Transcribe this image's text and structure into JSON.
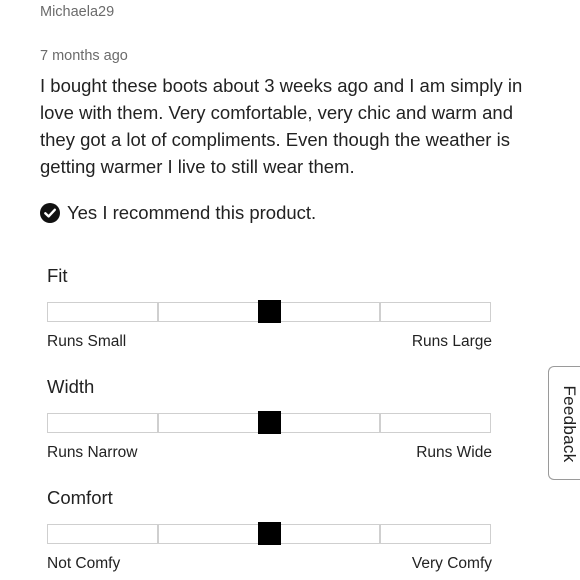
{
  "review": {
    "username": "Michaela29",
    "timestamp": "7 months ago",
    "body": "I bought these boots about 3 weeks ago and I am simply in love with them. Very comfortable, very chic and warm and they got a lot of compliments. Even though the weather is getting warmer I live to still wear them.",
    "recommend_text": "Yes I recommend this product."
  },
  "ratings": [
    {
      "title": "Fit",
      "left_label": "Runs Small",
      "right_label": "Runs Large",
      "value_fraction": 0.5
    },
    {
      "title": "Width",
      "left_label": "Runs Narrow",
      "right_label": "Runs Wide",
      "value_fraction": 0.5
    },
    {
      "title": "Comfort",
      "left_label": "Not Comfy",
      "right_label": "Very Comfy",
      "value_fraction": 0.5
    }
  ],
  "feedback": {
    "label": "Feedback"
  },
  "icons": {
    "recommend": "check-circle-icon"
  },
  "colors": {
    "marker": "#000000",
    "scale_border": "#cfcfcf",
    "meta_text": "#6b6b6b"
  }
}
